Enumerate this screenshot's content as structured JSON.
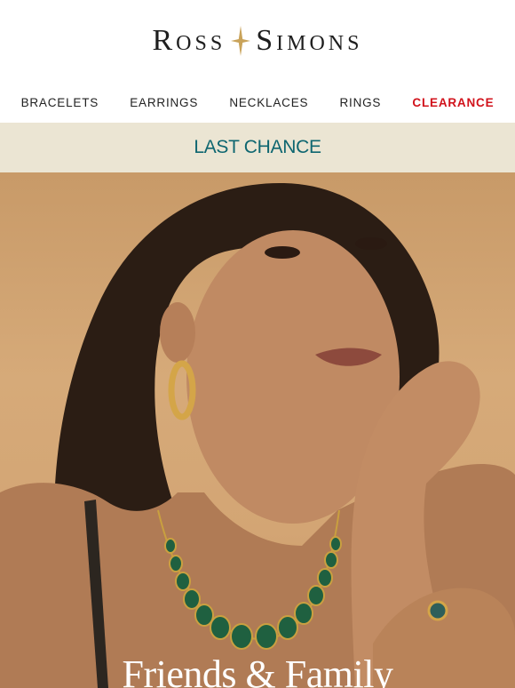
{
  "brand": {
    "left_word": "Ross",
    "right_word": "Simons",
    "star_icon": "four-point-star-icon",
    "star_color": "#c9a35a"
  },
  "nav": {
    "items": [
      {
        "label": "BRACELETS"
      },
      {
        "label": "EARRINGS"
      },
      {
        "label": "NECKLACES"
      },
      {
        "label": "RINGS"
      },
      {
        "label": "CLEARANCE",
        "color": "#d1121b"
      }
    ]
  },
  "banner": {
    "text": "LAST CHANCE",
    "background": "#ebe5d3",
    "text_color": "#0e6670"
  },
  "hero": {
    "headline": "Friends & Family",
    "image": "model-wearing-emerald-necklace-gold-hoop-earrings-and-ring"
  }
}
